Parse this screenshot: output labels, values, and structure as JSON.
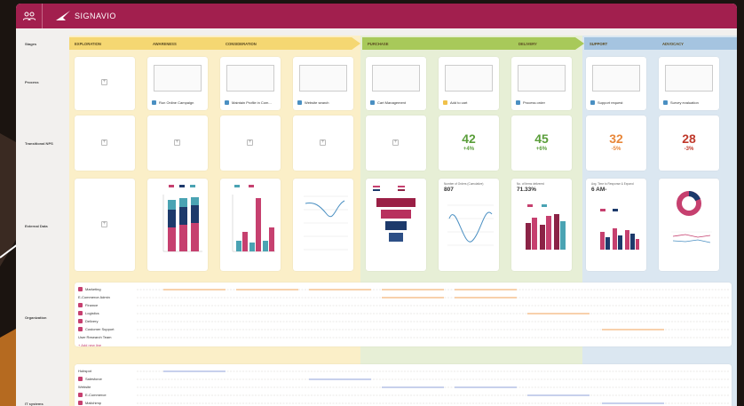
{
  "app": {
    "name": "SIGNAVIO"
  },
  "rows": {
    "stages": "Stages",
    "process": "Process",
    "nps": "Transitional NPS",
    "external": "External Data",
    "org": "Organization",
    "it": "IT systems"
  },
  "stages": [
    {
      "label": "EXPLORATION"
    },
    {
      "label": "AWARENESS"
    },
    {
      "label": "CONSIDERATION"
    },
    {
      "label": "PURCHASE"
    },
    {
      "label": "DELIVERY"
    },
    {
      "label": "SUPPORT"
    },
    {
      "label": "ADVOCACY"
    }
  ],
  "colors": {
    "header": "#a21f4e",
    "yellow": "#fbefc8",
    "green": "#e7efd6",
    "blue": "#dbe7f1",
    "accent_pink": "#c6406f"
  },
  "processes": [
    "Run Online Campaign",
    "Maintain Profile in Com...",
    "Website search",
    "Cart Management",
    "Add to cart",
    "Process order",
    "Support request",
    "Survey evaluation"
  ],
  "nps": [
    {
      "value": "42",
      "delta": "+4%",
      "color": "#5a9e3a"
    },
    {
      "value": "45",
      "delta": "+6%",
      "color": "#5a9e3a"
    },
    {
      "value": "32",
      "delta": "-5%",
      "color": "#e8873a"
    },
    {
      "value": "28",
      "delta": "-3%",
      "color": "#c0392b"
    }
  ],
  "charts": {
    "delivery_metric": {
      "title": "No. of Items delivered",
      "value": "71.33%"
    },
    "orders_metric": {
      "title": "Number of Orders (Cumulative)",
      "value": "807"
    },
    "support_metric": {
      "title": "Avg. Time to Response & Expand",
      "value": "6 AM-"
    }
  },
  "organization": [
    "Marketing",
    "E-Commerce Admin",
    "Finance",
    "Logistics",
    "Delivery",
    "Customer Support",
    "User Research Team"
  ],
  "org_add": "+ Add new line",
  "it_systems": [
    "Hubspot",
    "Salesforce",
    "Website",
    "E-Commerce",
    "Mailchimp"
  ]
}
